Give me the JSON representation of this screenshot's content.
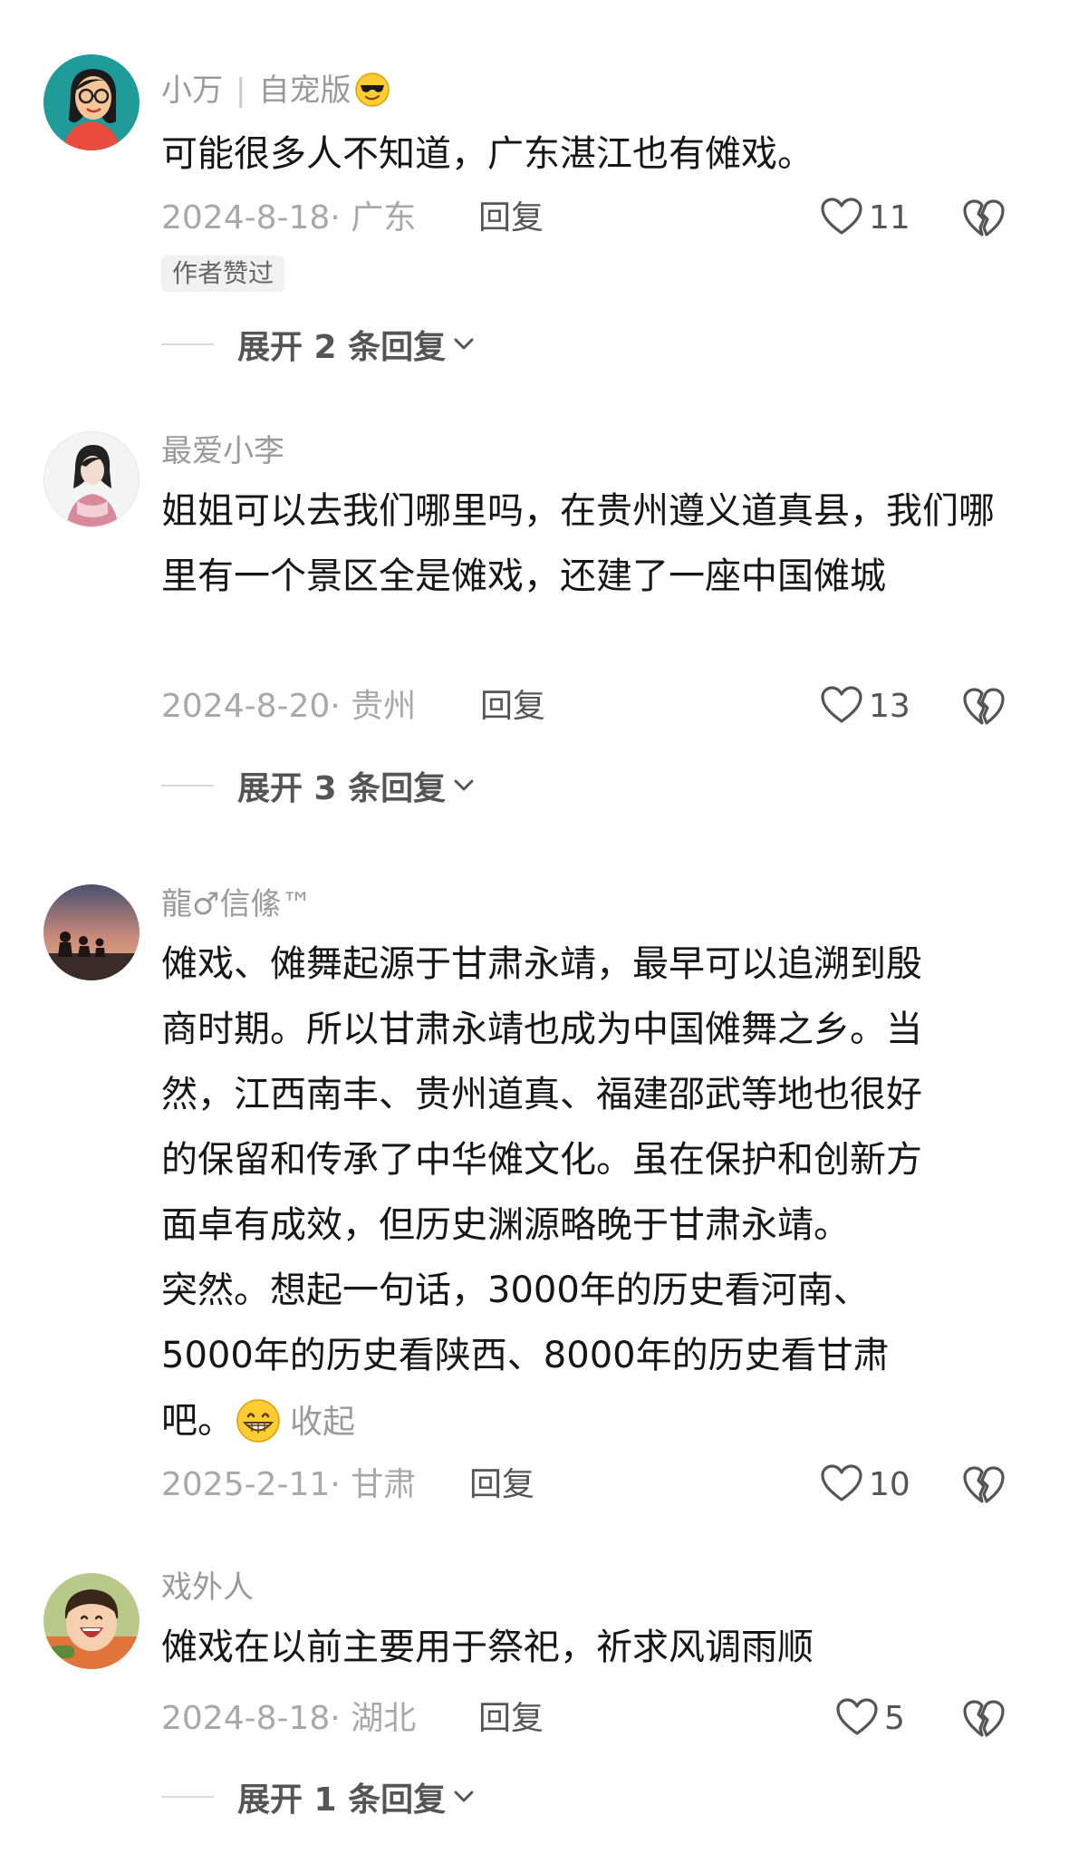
{
  "comments": [
    {
      "username": "小万",
      "tag": "自宠版",
      "text": "可能很多人不知道，广东湛江也有傩戏。",
      "date": "2024-8-18· 广东",
      "reply_label": "回复",
      "likes": "11",
      "badge": "作者赞过",
      "expand_label": "展开 2 条回复"
    },
    {
      "username": "最爱小李",
      "text": "姐姐可以去我们哪里吗，在贵州遵义道真县，我们哪里有一个景区全是傩戏，还建了一座中国傩城",
      "date": "2024-8-20· 贵州",
      "reply_label": "回复",
      "likes": "13",
      "expand_label": "展开 3 条回复"
    },
    {
      "username": "龍♂信絛™",
      "text_lines": [
        "傩戏、傩舞起源于甘肃永靖，最早可以追溯到殷",
        "商时期。所以甘肃永靖也成为中国傩舞之乡。当",
        "然，江西南丰、贵州道真、福建邵武等地也很好",
        "的保留和传承了中华傩文化。虽在保护和创新方",
        "面卓有成效，但历史渊源略晚于甘肃永靖。",
        "突然。想起一句话，3000年的历史看河南、",
        "5000年的历史看陕西、8000年的历史看甘肃",
        "吧。"
      ],
      "collapse_label": "收起",
      "date": "2025-2-11· 甘肃",
      "reply_label": "回复",
      "likes": "10"
    },
    {
      "username": "戏外人",
      "text": "傩戏在以前主要用于祭祀，祈求风调雨顺",
      "date": "2024-8-18· 湖北",
      "reply_label": "回复",
      "likes": "5",
      "expand_label": "展开 1 条回复"
    }
  ],
  "icons": {
    "like": "heart-outline-icon",
    "dislike": "broken-heart-icon",
    "expand": "chevron-down-icon",
    "name_emoji": "sunglasses-emoji",
    "text_emoji": "grin-emoji"
  },
  "colors": {
    "text": "#161616",
    "muted": "#9a9a9a",
    "action": "#555555"
  }
}
